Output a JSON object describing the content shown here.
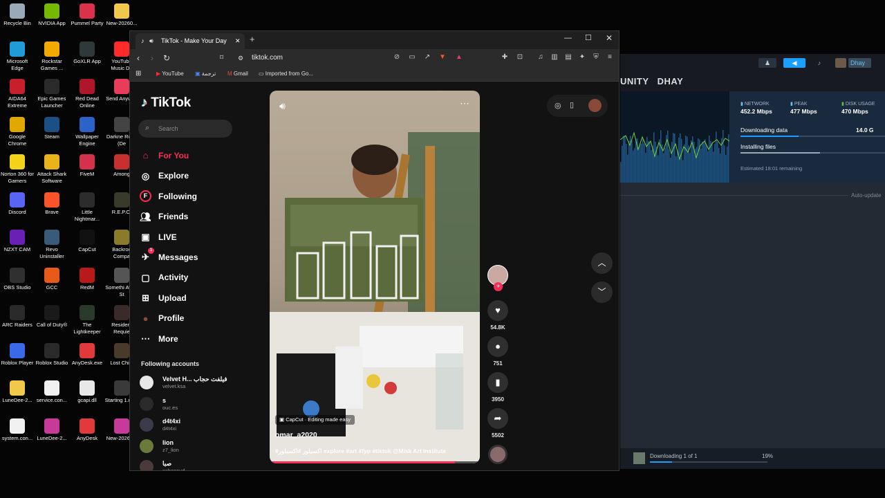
{
  "desktop": {
    "icons": [
      {
        "label": "Recycle Bin",
        "color": "#9aa8b8"
      },
      {
        "label": "NVIDIA App",
        "color": "#76b900"
      },
      {
        "label": "Pummel Party",
        "color": "#d9324a"
      },
      {
        "label": "New-20260...",
        "color": "#f2c84b"
      },
      {
        "label": "Microsoft Edge",
        "color": "#1f9bd8"
      },
      {
        "label": "Rockstar Games ...",
        "color": "#f2a900"
      },
      {
        "label": "GoXLR App",
        "color": "#2e3a3a"
      },
      {
        "label": "YouTube Music De",
        "color": "#ff2a2a"
      },
      {
        "label": "AIDA64 Extreme",
        "color": "#c8202a"
      },
      {
        "label": "Epic Games Launcher",
        "color": "#2a2a2a"
      },
      {
        "label": "Red Dead Online",
        "color": "#b0162a"
      },
      {
        "label": "Send Anywhe",
        "color": "#e83c5a"
      },
      {
        "label": "Google Chrome",
        "color": "#e0a800"
      },
      {
        "label": "Steam",
        "color": "#1b4f86"
      },
      {
        "label": "Wallpaper Engine",
        "color": "#2b63c8"
      },
      {
        "label": "Darkne Road (De",
        "color": "#444"
      },
      {
        "label": "Norton 360 for Gamers",
        "color": "#f5d21a"
      },
      {
        "label": "Attack Shark Software",
        "color": "#e8b21a"
      },
      {
        "label": "FiveM",
        "color": "#d4314a"
      },
      {
        "label": "Among",
        "color": "#c83030"
      },
      {
        "label": "Discord",
        "color": "#5865f2"
      },
      {
        "label": "Brave",
        "color": "#fb542b"
      },
      {
        "label": "Little Nightmar...",
        "color": "#2c2c2c"
      },
      {
        "label": "R.E.P.O.",
        "color": "#3a3a2a"
      },
      {
        "label": "NZXT CAM",
        "color": "#6a1fb5"
      },
      {
        "label": "Revo Uninstaller",
        "color": "#3a5a7a"
      },
      {
        "label": "CapCut",
        "color": "#111"
      },
      {
        "label": "Backroo Compa",
        "color": "#8a7a2a"
      },
      {
        "label": "OBS Studio",
        "color": "#303030"
      },
      {
        "label": "GCC",
        "color": "#e85a1a"
      },
      {
        "label": "RedM",
        "color": "#b81a1a"
      },
      {
        "label": "Somethi Awful St",
        "color": "#555"
      },
      {
        "label": "ARC Raiders",
        "color": "#2a2a2a"
      },
      {
        "label": "Call of Duty®",
        "color": "#1a1a1a"
      },
      {
        "label": "The Lightkeeper",
        "color": "#2a3a2a"
      },
      {
        "label": "Resident Requie",
        "color": "#3a2a2a"
      },
      {
        "label": "Roblox Player",
        "color": "#3a6ae8"
      },
      {
        "label": "Roblox Studio",
        "color": "#2a2a2a"
      },
      {
        "label": "AnyDesk.exe",
        "color": "#e23a3a"
      },
      {
        "label": "Lost Child",
        "color": "#4a3a2a"
      },
      {
        "label": "LuneDee-2...",
        "color": "#f2c84b"
      },
      {
        "label": "service.con...",
        "color": "#f0f0f0"
      },
      {
        "label": "gcapi.dll",
        "color": "#e8e8e8"
      },
      {
        "label": "Starting 1.mp4",
        "color": "#3a3a3a"
      },
      {
        "label": "system.con...",
        "color": "#f0f0f0"
      },
      {
        "label": "LuneDee-2...",
        "color": "#c83a9a"
      },
      {
        "label": "AnyDesk",
        "color": "#e23a3a"
      },
      {
        "label": "New-20260...",
        "color": "#c83a9a"
      }
    ]
  },
  "steam": {
    "nav_text": "UNITY   DHAY",
    "user": "Dhay",
    "stats": [
      {
        "label": "NETWORK",
        "value": "452.2 Mbps",
        "color": "#66c0f4"
      },
      {
        "label": "PEAK",
        "value": "477 Mbps",
        "color": "#66c0f4"
      },
      {
        "label": "DISK USAGE",
        "value": "470 Mbps",
        "color": "#5cbf3a"
      }
    ],
    "status1": "Downloading data",
    "status1_value": "14.0 G",
    "status2": "Installing files",
    "remaining": "Estimated 18:01 remaining",
    "auto_updates": "Auto-update",
    "downloading_footer": "Downloading 1 of 1",
    "footer_percent": "19%",
    "download_progress": 0.19
  },
  "browser": {
    "tab_title": "TikTok - Make Your Day",
    "url": "tiktok.com",
    "bookmarks": [
      {
        "label": "YouTube",
        "icon": "youtube-icon"
      },
      {
        "label": "ترجمة",
        "icon": "translate-icon"
      },
      {
        "label": "Gmail",
        "icon": "gmail-icon"
      },
      {
        "label": "Imported from Go...",
        "icon": "folder-icon"
      }
    ]
  },
  "tiktok": {
    "logo": "TikTok",
    "search_placeholder": "Search",
    "nav": [
      {
        "label": "For You",
        "icon": "home-icon",
        "active": true
      },
      {
        "label": "Explore",
        "icon": "compass-icon"
      },
      {
        "label": "Following",
        "icon": "following-icon"
      },
      {
        "label": "Friends",
        "icon": "friends-icon"
      },
      {
        "label": "LIVE",
        "icon": "live-icon"
      },
      {
        "label": "Messages",
        "icon": "messages-icon",
        "badge": "1"
      },
      {
        "label": "Activity",
        "icon": "activity-icon"
      },
      {
        "label": "Upload",
        "icon": "upload-icon"
      },
      {
        "label": "Profile",
        "icon": "profile-icon"
      },
      {
        "label": "More",
        "icon": "more-icon"
      }
    ],
    "following_title": "Following accounts",
    "accounts": [
      {
        "name": "Velvet H... فيلفت حجاب",
        "handle": "velvet.ksa"
      },
      {
        "name": "s",
        "handle": "ouc.es"
      },
      {
        "name": "d4t4xi",
        "handle": "d4t4xi"
      },
      {
        "name": "lion",
        "handle": "z7_lion"
      },
      {
        "name": "صبا",
        "handle": "sabasaud"
      }
    ],
    "video": {
      "capcut": "CapCut · Editing made easy",
      "author": "omar_a2020",
      "caption": "#اكسيلور #اكسبلور explore #art #fyp #tiktok @Misk Art Institute",
      "progress": 0.88
    },
    "actions": [
      {
        "icon": "heart-icon",
        "count": "54.8K"
      },
      {
        "icon": "comment-icon",
        "count": "751"
      },
      {
        "icon": "bookmark-icon",
        "count": "3950"
      },
      {
        "icon": "share-icon",
        "count": "5502"
      }
    ]
  }
}
